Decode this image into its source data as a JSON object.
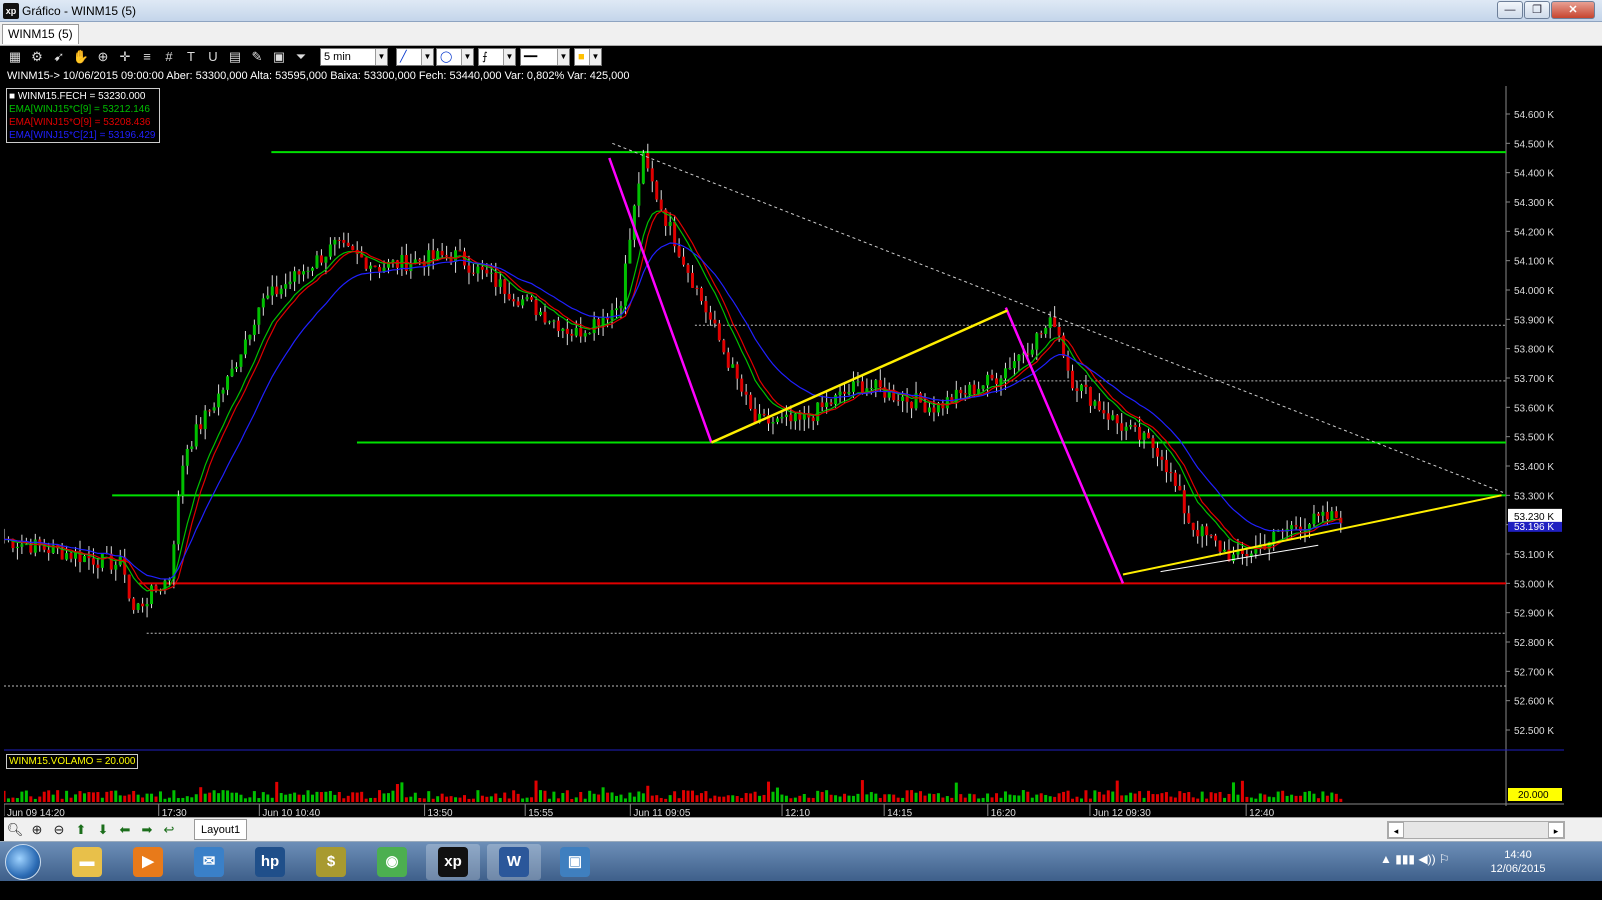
{
  "window": {
    "title": "Gráfico - WINM15 (5)",
    "app_icon_text": "xp",
    "min_glyph": "—",
    "max_glyph": "❐",
    "close_glyph": "✕"
  },
  "tabs": [
    {
      "label": "WINM15 (5)"
    }
  ],
  "toolbar": {
    "icons": [
      "chart-icon",
      "gear-icon",
      "cursor-icon",
      "hand-icon",
      "zoom-icon",
      "crosshair-icon",
      "lines-icon",
      "grid-icon",
      "text-icon",
      "magnet-icon",
      "calculator-icon",
      "brush-icon",
      "lock-icon",
      "filter-icon"
    ],
    "period_select": "5 min"
  },
  "info_line": "WINM15-> 10/06/2015 09:00:00 Aber: 53300,000 Alta: 53595,000 Baixa: 53300,000 Fech: 53440,000 Var: 0,802% Var: 425,000",
  "legend": [
    {
      "text": "WINM15.FECH = 53230.000",
      "color": "#ffffff"
    },
    {
      "text": "EMA[WINJ15*C[9] = 53212.146",
      "color": "#00c000"
    },
    {
      "text": "EMA[WINJ15*O[9] = 53208.436",
      "color": "#e00000"
    },
    {
      "text": "EMA[WINJ15*C[21] = 53196.429",
      "color": "#2020ff"
    }
  ],
  "volume_label": "WINM15.VOLAMO = 20.000",
  "colors": {
    "price": "#ffffff",
    "ema9c": "#00c000",
    "ema9o": "#e00000",
    "ema21": "#2020ff",
    "support_green": "#00e000",
    "support_red": "#e00000",
    "trend_yellow": "#ffee00",
    "trend_magenta": "#ff00ff",
    "up_candle": "#00c000",
    "down_candle": "#e00000"
  },
  "chart_data": {
    "type": "line",
    "title": "",
    "x_ticks": [
      "Jun 09 14:20",
      "17:30",
      "Jun 10 10:40",
      "13:50",
      "15:55",
      "Jun 11 09:05",
      "12:10",
      "14:15",
      "16:20",
      "Jun 12 09:30",
      "12:40"
    ],
    "y_ticks": [
      "54.600 K",
      "54.500 K",
      "54.400 K",
      "54.300 K",
      "54.200 K",
      "54.100 K",
      "54.000 K",
      "53.900 K",
      "53.800 K",
      "53.700 K",
      "53.600 K",
      "53.500 K",
      "53.400 K",
      "53.300 K",
      "53.200 K",
      "53.100 K",
      "53.000 K",
      "52.900 K",
      "52.800 K",
      "52.700 K",
      "52.600 K",
      "52.500 K"
    ],
    "ylim": [
      52500,
      54600
    ],
    "current_price_label": "53.230 K",
    "ema21_price_label": "53.196 K",
    "volume_axis_label": "20.000",
    "series_key_points": [
      {
        "t": 0,
        "close": 53150
      },
      {
        "t": 0.08,
        "close": 53060
      },
      {
        "t": 0.085,
        "close": 52900
      },
      {
        "t": 0.11,
        "close": 53020
      },
      {
        "t": 0.12,
        "close": 53450
      },
      {
        "t": 0.15,
        "close": 53700
      },
      {
        "t": 0.17,
        "close": 53950
      },
      {
        "t": 0.22,
        "close": 54150
      },
      {
        "t": 0.25,
        "close": 54080
      },
      {
        "t": 0.3,
        "close": 54120
      },
      {
        "t": 0.35,
        "close": 53950
      },
      {
        "t": 0.38,
        "close": 53850
      },
      {
        "t": 0.41,
        "close": 53950
      },
      {
        "t": 0.425,
        "close": 54450
      },
      {
        "t": 0.44,
        "close": 54250
      },
      {
        "t": 0.47,
        "close": 53900
      },
      {
        "t": 0.5,
        "close": 53550
      },
      {
        "t": 0.53,
        "close": 53550
      },
      {
        "t": 0.57,
        "close": 53680
      },
      {
        "t": 0.62,
        "close": 53600
      },
      {
        "t": 0.66,
        "close": 53700
      },
      {
        "t": 0.7,
        "close": 53900
      },
      {
        "t": 0.71,
        "close": 53700
      },
      {
        "t": 0.74,
        "close": 53550
      },
      {
        "t": 0.77,
        "close": 53450
      },
      {
        "t": 0.79,
        "close": 53200
      },
      {
        "t": 0.82,
        "close": 53080
      },
      {
        "t": 0.86,
        "close": 53200
      },
      {
        "t": 0.89,
        "close": 53230
      }
    ],
    "horizontal_levels": [
      {
        "value": 54470,
        "color": "green",
        "style": "solid"
      },
      {
        "value": 53880,
        "color": "white",
        "style": "dotted"
      },
      {
        "value": 53690,
        "color": "white",
        "style": "dotted"
      },
      {
        "value": 53480,
        "color": "green",
        "style": "solid"
      },
      {
        "value": 53300,
        "color": "green",
        "style": "solid"
      },
      {
        "value": 53000,
        "color": "red",
        "style": "solid"
      },
      {
        "value": 52830,
        "color": "white",
        "style": "dotted"
      },
      {
        "value": 52650,
        "color": "white",
        "style": "dotted"
      }
    ]
  },
  "nav": {
    "layout_tab": "Layout1",
    "icons": [
      "magnifier-icon",
      "zoom-in-icon",
      "zoom-out-icon",
      "arrow-up-icon",
      "arrow-down-icon",
      "arrow-left-icon",
      "arrow-right-icon",
      "arrow-back-icon"
    ],
    "scroll_left": "◂",
    "scroll_right": "▸"
  },
  "taskbar": {
    "apps": [
      "explorer",
      "media-player",
      "network",
      "hp",
      "finance",
      "chrome",
      "xp",
      "word",
      "image"
    ],
    "xp_label": "xp",
    "word_label": "W",
    "time": "14:40",
    "date": "12/06/2015"
  }
}
